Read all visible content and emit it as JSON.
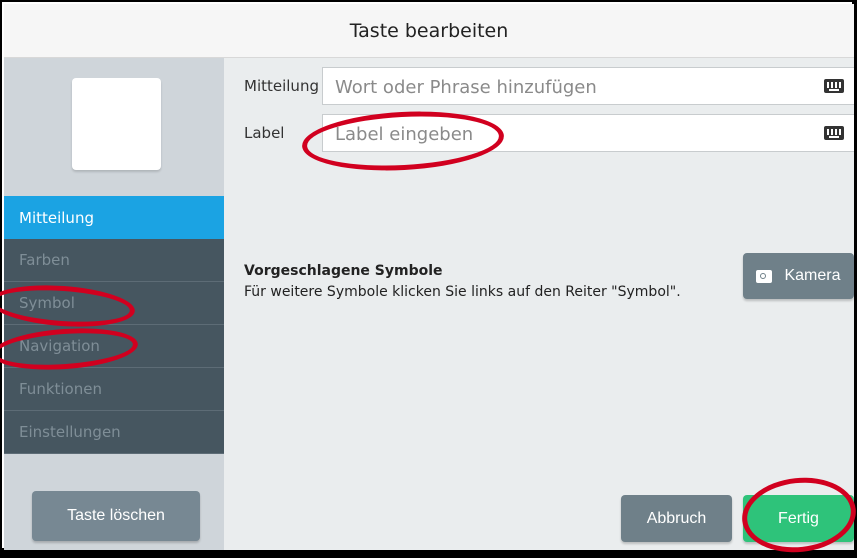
{
  "dialog": {
    "title": "Taste bearbeiten"
  },
  "sidebar": {
    "items": [
      {
        "label": "Mitteilung",
        "active": true
      },
      {
        "label": "Farben"
      },
      {
        "label": "Symbol"
      },
      {
        "label": "Navigation"
      },
      {
        "label": "Funktionen"
      },
      {
        "label": "Einstellungen"
      }
    ],
    "delete_label": "Taste löschen"
  },
  "form": {
    "message": {
      "label": "Mitteilung",
      "placeholder": "Wort oder Phrase hinzufügen"
    },
    "label": {
      "label": "Label",
      "placeholder": "Label eingeben"
    }
  },
  "suggestions": {
    "title": "Vorgeschlagene Symbole",
    "hint": "Für weitere Symbole klicken Sie links auf den Reiter \"Symbol\"."
  },
  "buttons": {
    "camera": "Kamera",
    "cancel": "Abbruch",
    "done": "Fertig"
  },
  "icons": {
    "keyboard": "keyboard-icon",
    "camera": "camera-icon"
  },
  "colors": {
    "active_tab": "#1ba3e3",
    "done": "#2ec37a",
    "annotation": "#d1001f"
  }
}
